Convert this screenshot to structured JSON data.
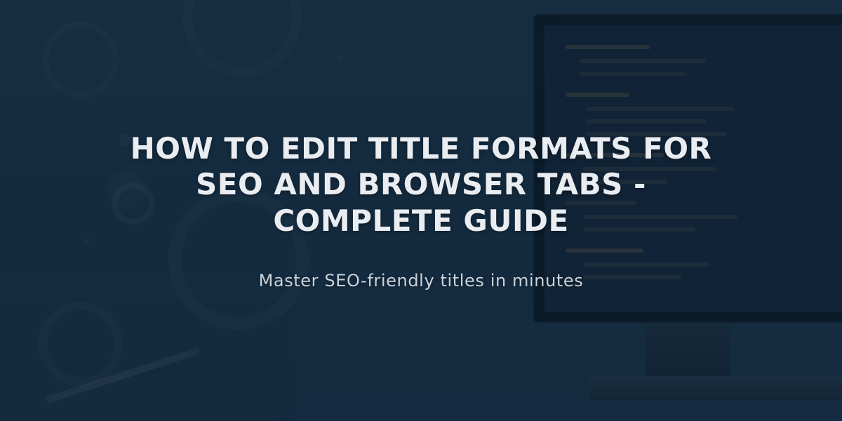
{
  "hero": {
    "title": "HOW TO EDIT TITLE FORMATS FOR SEO AND BROWSER TABS - COMPLETE GUIDE",
    "subtitle": "Master SEO-friendly titles in minutes"
  }
}
